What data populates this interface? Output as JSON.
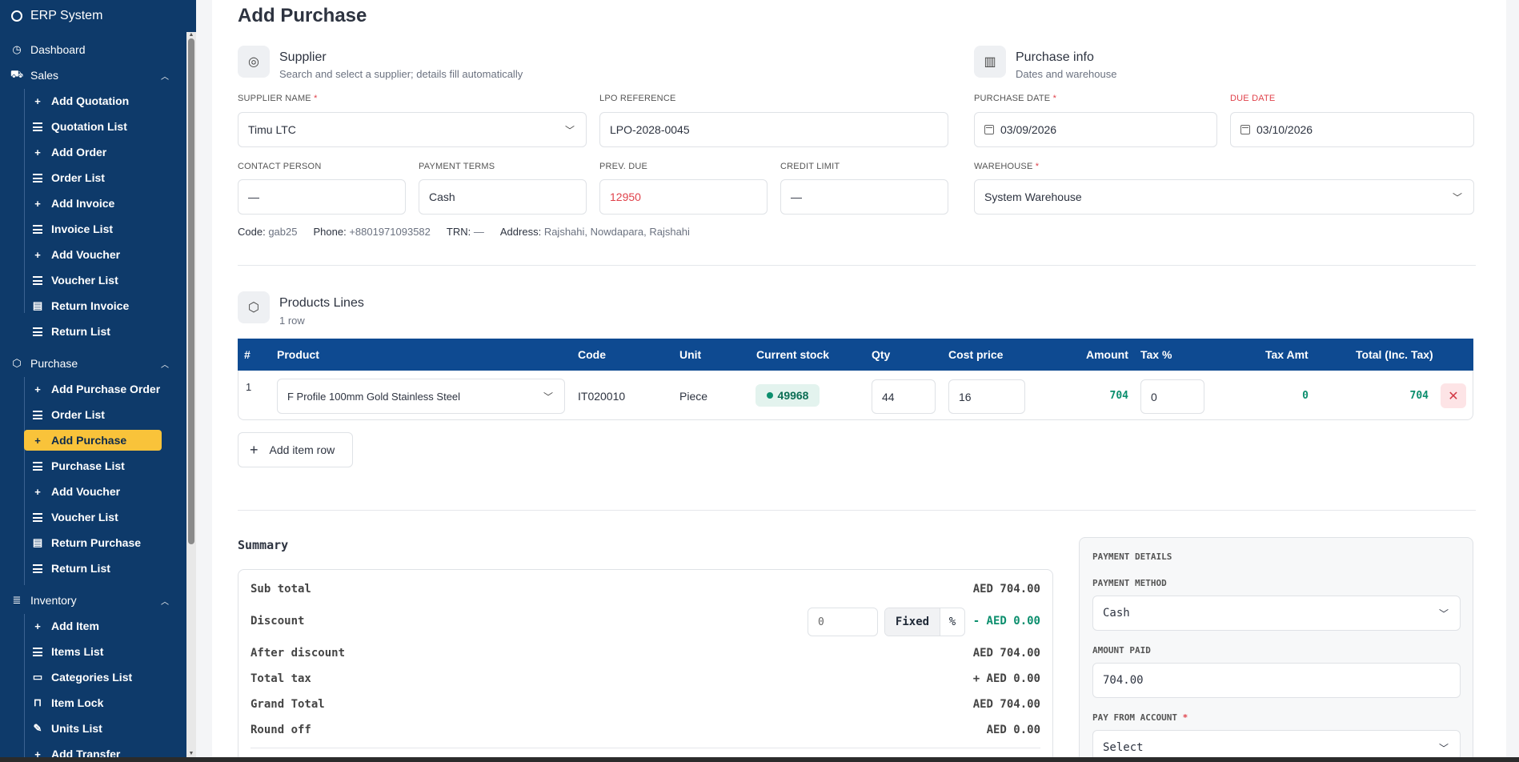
{
  "app": {
    "title": "ERP System"
  },
  "sidebar": {
    "dashboard": "Dashboard",
    "sales": {
      "label": "Sales",
      "items": [
        "Add Quotation",
        "Quotation List",
        "Add Order",
        "Order List",
        "Add Invoice",
        "Invoice List",
        "Add Voucher",
        "Voucher List",
        "Return Invoice",
        "Return List"
      ]
    },
    "purchase": {
      "label": "Purchase",
      "items": [
        "Add Purchase Order",
        "Order List",
        "Add Purchase",
        "Purchase List",
        "Add Voucher",
        "Voucher List",
        "Return Purchase",
        "Return List"
      ]
    },
    "inventory": {
      "label": "Inventory",
      "items": [
        "Add Item",
        "Items List",
        "Categories List",
        "Item Lock",
        "Units List",
        "Add Transfer"
      ]
    }
  },
  "page": {
    "title": "Add Purchase"
  },
  "supplier_section": {
    "title": "Supplier",
    "subtitle": "Search and select a supplier; details fill automatically",
    "supplier_name_label": "SUPPLIER NAME",
    "supplier_name": "Timu LTC",
    "lpo_label": "LPO REFERENCE",
    "lpo": "LPO-2028-0045",
    "contact_label": "CONTACT PERSON",
    "contact": "—",
    "payment_terms_label": "PAYMENT TERMS",
    "payment_terms": "Cash",
    "prev_due_label": "PREV. DUE",
    "prev_due": "12950",
    "credit_limit_label": "CREDIT LIMIT",
    "credit_limit": "—",
    "info": {
      "code_label": "Code:",
      "code": "gab25",
      "phone_label": "Phone:",
      "phone": "+8801971093582",
      "trn_label": "TRN:",
      "trn": "—",
      "address_label": "Address:",
      "address": "Rajshahi, Nowdapara, Rajshahi"
    }
  },
  "purchase_info": {
    "title": "Purchase info",
    "subtitle": "Dates and warehouse",
    "purchase_date_label": "PURCHASE DATE",
    "purchase_date": "03/09/2026",
    "due_date_label": "DUE DATE",
    "due_date": "03/10/2026",
    "warehouse_label": "WAREHOUSE",
    "warehouse": "System Warehouse"
  },
  "products": {
    "title": "Products Lines",
    "subtitle": "1 row",
    "columns": [
      "#",
      "Product",
      "Code",
      "Unit",
      "Current stock",
      "Qty",
      "Cost price",
      "Amount",
      "Tax %",
      "Tax Amt",
      "Total (Inc. Tax)"
    ],
    "rows": [
      {
        "num": "1",
        "product": "F Profile 100mm Gold Stainless Steel",
        "code": "IT020010",
        "unit": "Piece",
        "stock": "49968",
        "qty": "44",
        "cost": "16",
        "amount": "704",
        "tax_pct": "0",
        "tax_amt": "0",
        "total": "704"
      }
    ],
    "add_row_label": "Add item row"
  },
  "summary": {
    "title": "Summary",
    "sub_total_label": "Sub total",
    "sub_total": "AED 704.00",
    "discount_label": "Discount",
    "discount_input": "0",
    "discount_fixed": "Fixed",
    "discount_pct": "%",
    "discount_value": "- AED 0.00",
    "after_discount_label": "After discount",
    "after_discount": "AED 704.00",
    "total_tax_label": "Total tax",
    "total_tax": "+ AED 0.00",
    "grand_total_label": "Grand Total",
    "grand_total": "AED 704.00",
    "round_off_label": "Round off",
    "round_off": "AED 0.00"
  },
  "payment": {
    "title": "PAYMENT DETAILS",
    "method_label": "PAYMENT METHOD",
    "method": "Cash",
    "amount_label": "AMOUNT PAID",
    "amount": "704.00",
    "account_label": "PAY FROM ACCOUNT",
    "account": "Select"
  },
  "colors": {
    "sidebar": "#0e3a6a",
    "active": "#f9c33a",
    "table_header": "#0e4a91",
    "accent_green": "#0c8f6e",
    "danger": "#e0424b"
  }
}
